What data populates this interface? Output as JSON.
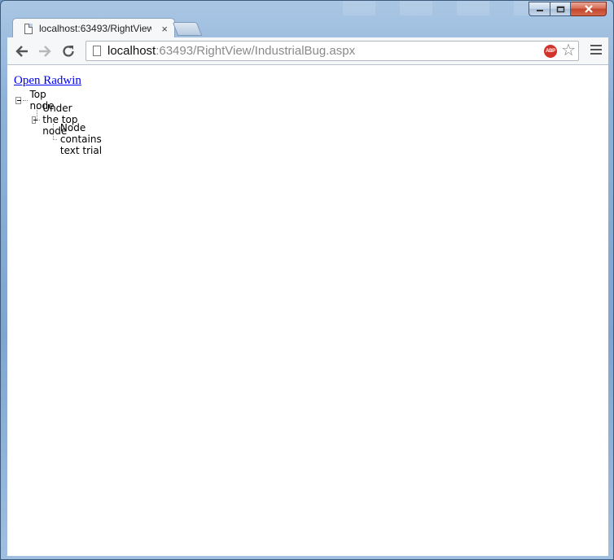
{
  "window": {
    "controls": [
      "minimize",
      "maximize",
      "close"
    ]
  },
  "tab": {
    "title": "localhost:63493/RightView",
    "close_glyph": "×",
    "icon": "page-icon"
  },
  "toolbar": {
    "back_icon": "arrow-left-icon",
    "forward_icon": "arrow-right-icon",
    "reload_icon": "reload-icon",
    "url_host": "localhost",
    "url_rest": ":63493/RightView/IndustrialBug.aspx",
    "adblock_label": "ABP",
    "bookmark_glyph": "☆",
    "menu_icon": "hamburger-menu-icon"
  },
  "page": {
    "link_text": "Open Radwin",
    "tree": {
      "root": "Top node",
      "child": "Under the top node",
      "grandchild": "Node contains text trial"
    }
  },
  "colors": {
    "link": "#0000ee",
    "close_button": "#c4452c",
    "frame": "#8fb2d8"
  }
}
